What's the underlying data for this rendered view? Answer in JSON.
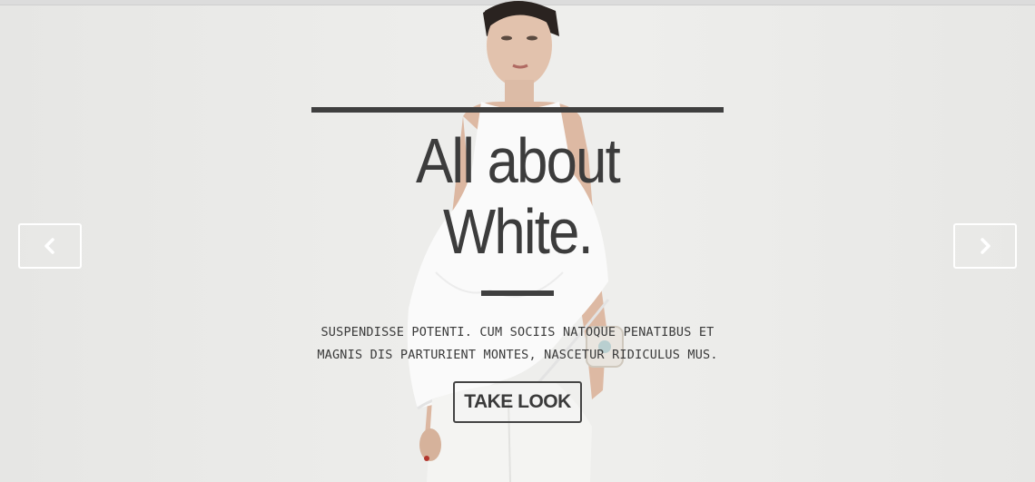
{
  "slide": {
    "title": "All about White.",
    "text": "SUSPENDISSE POTENTI. CUM SOCIIS NATOQUE PENATIBUS ET MAGNIS DIS PARTURIENT MONTES, NASCETUR RIDICULUS MUS.",
    "button_label": "TAKE LOOK"
  },
  "controls": {
    "prev_icon": "chevron-left-icon",
    "next_icon": "chevron-right-icon"
  },
  "colors": {
    "text": "#3c3c3c",
    "background": "#ececea",
    "arrow_border": "#ffffff"
  }
}
